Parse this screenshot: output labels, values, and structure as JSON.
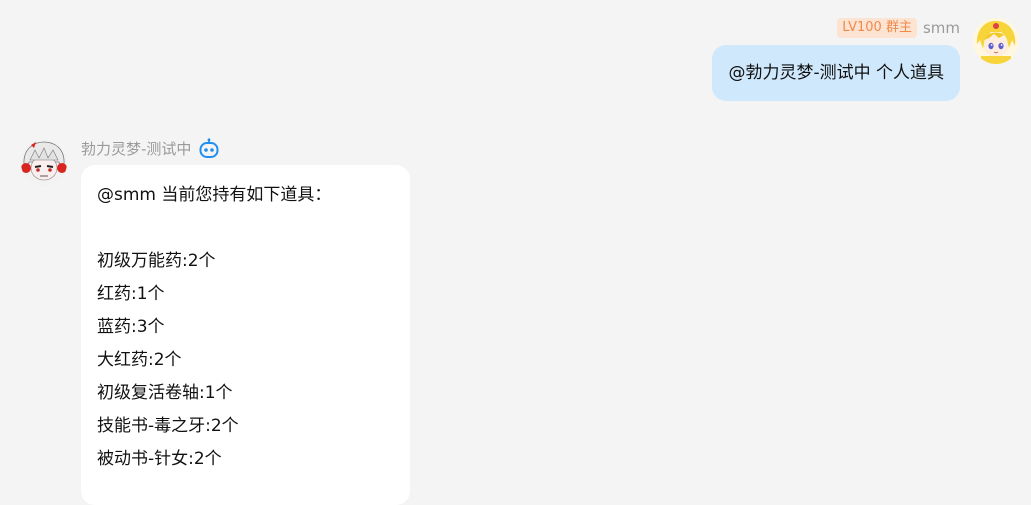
{
  "outgoing": {
    "level_badge": "LV100 群主",
    "sender": "smm",
    "text": "@勃力灵梦-测试中  个人道具"
  },
  "incoming": {
    "sender": "勃力灵梦-测试中",
    "lines": [
      "@smm   当前您持有如下道具：",
      "",
      "初级万能药:2个",
      "红药:1个",
      "蓝药:3个",
      "大红药:2个",
      "初级复活卷轴:1个",
      "技能书-毒之牙:2个",
      "被动书-针女:2个"
    ]
  },
  "icons": {
    "bot": "robot-icon",
    "avatar_out": "anime-avatar-blonde",
    "avatar_in": "anime-avatar-white-hair"
  },
  "colors": {
    "background": "#f4f4f4",
    "bubble_out": "#cfe8fc",
    "bubble_in": "#ffffff",
    "badge_bg": "#fde3d2",
    "badge_text": "#f08a4b",
    "bot_icon": "#1f8ef1"
  }
}
